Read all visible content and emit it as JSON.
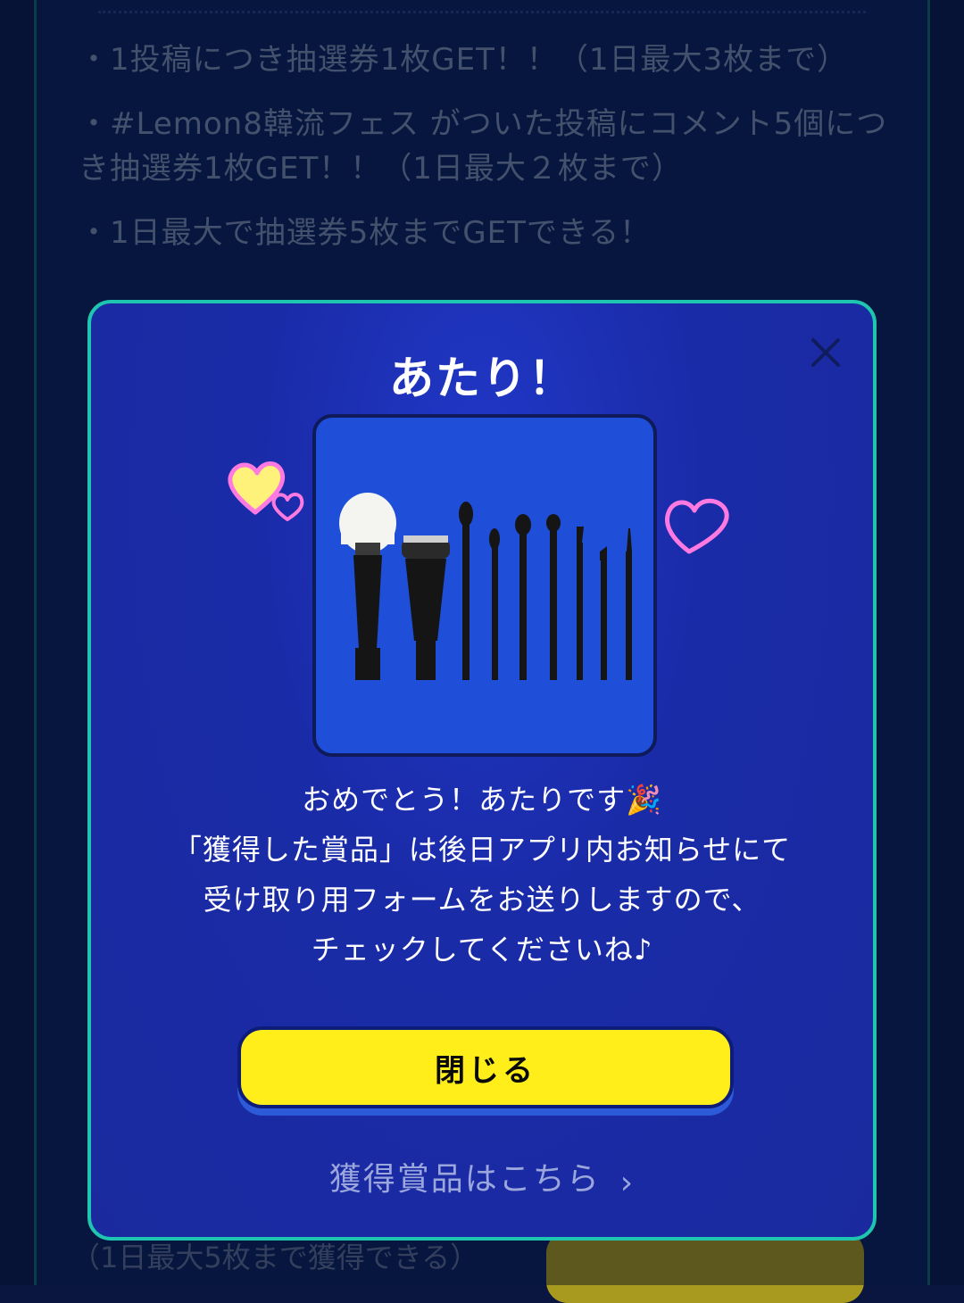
{
  "background": {
    "rules": [
      "・1投稿につき抽選券1枚GET！！（1日最大3枚まで）",
      "・#Lemon8韓流フェス がついた投稿にコメント5個につき抽選券1枚GET！！（1日最大２枚まで）",
      "・1日最大で抽選券5枚までGETできる！"
    ],
    "bottom_text": "（1日最大5枚まで獲得できる）"
  },
  "modal": {
    "title": "あたり！",
    "message_lines": [
      "おめでとう！あたりです🎉",
      "「獲得した賞品」は後日アプリ内お知らせにて",
      "受け取り用フォームをお送りしますので、",
      "チェックしてくださいね♪"
    ],
    "close_button_label": "閉じる",
    "prize_link_label": "獲得賞品はこちら",
    "prize_link_chevron": "›"
  },
  "colors": {
    "modal_border": "#1ec6b0",
    "modal_bg": "#1a2ba8",
    "button_yellow": "#ffee1a"
  },
  "icons": {
    "close": "close-icon",
    "heart": "heart-icon",
    "chevron": "chevron-right-icon"
  }
}
